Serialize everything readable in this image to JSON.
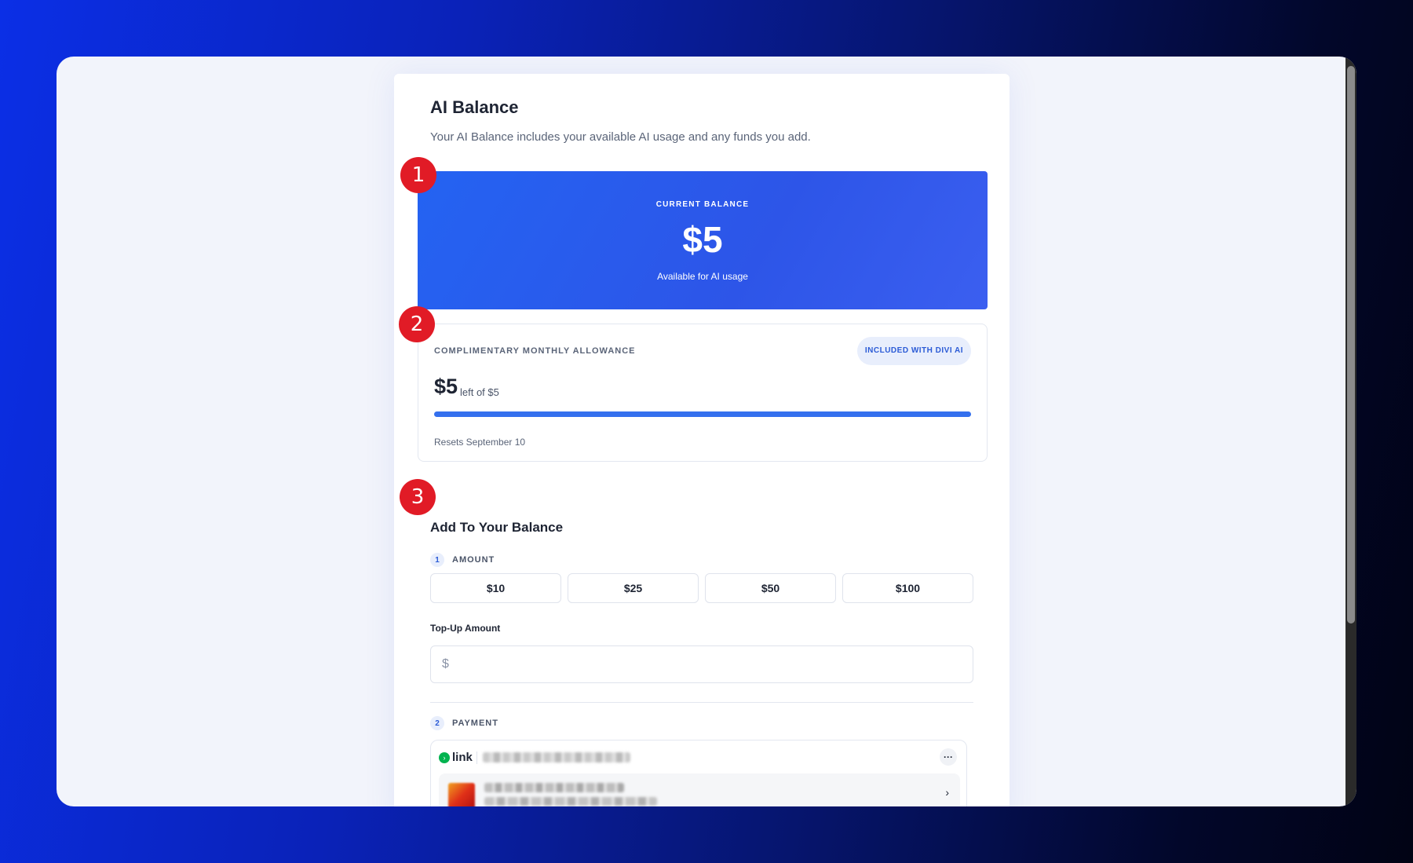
{
  "page": {
    "title": "AI Balance",
    "subtitle": "Your AI Balance includes your available AI usage and any funds you add."
  },
  "current_balance": {
    "label": "CURRENT BALANCE",
    "amount": "$5",
    "caption": "Available for AI usage",
    "color": "#2d5cf0"
  },
  "allowance": {
    "label": "COMPLIMENTARY MONTHLY ALLOWANCE",
    "badge": "INCLUDED WITH DIVI AI",
    "amount": "$5",
    "of_text": "left of $5",
    "progress_fraction": 1.0,
    "reset": "Resets September 10"
  },
  "add_balance": {
    "title": "Add To Your Balance",
    "amount_step": {
      "number": "1",
      "label": "AMOUNT"
    },
    "options": [
      "$10",
      "$25",
      "$50",
      "$100"
    ],
    "topup_label": "Top-Up Amount",
    "currency_symbol": "$",
    "topup_value": "",
    "payment_step": {
      "number": "2",
      "label": "PAYMENT"
    }
  },
  "payment": {
    "provider": "link",
    "provider_icon": "chevron-right-icon",
    "more_icon": "ellipsis",
    "chevron": "›"
  },
  "annotations": {
    "markers": [
      "1",
      "2",
      "3"
    ],
    "color": "#e11b26"
  }
}
